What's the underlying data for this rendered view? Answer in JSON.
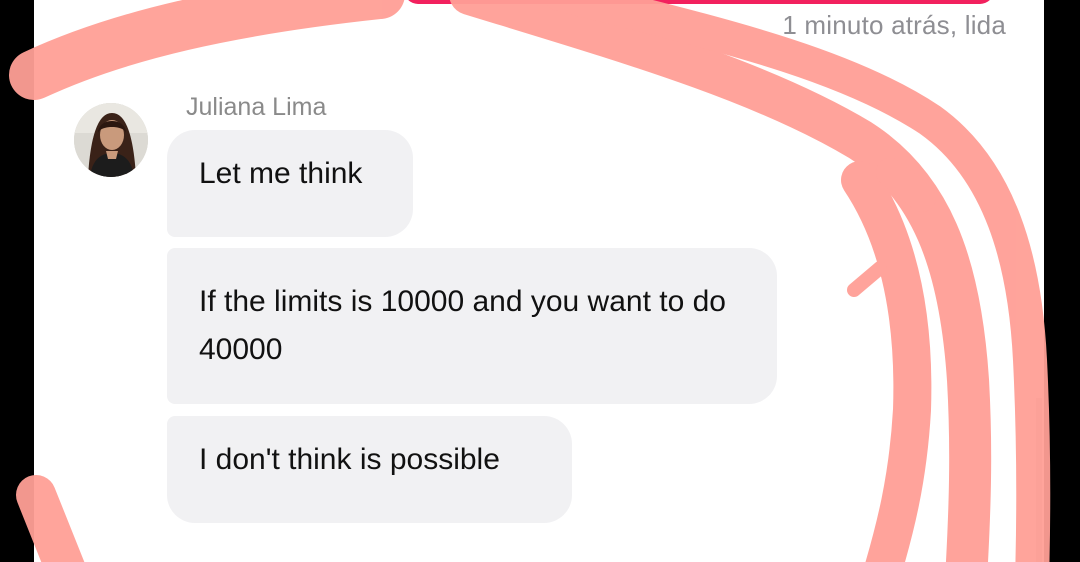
{
  "message_meta": {
    "timestamp": "1 minuto atrás, lida"
  },
  "sender": {
    "name": "Juliana Lima"
  },
  "messages": [
    {
      "text": "Let me think"
    },
    {
      "text": "If the limits is 10000 and you want to do 40000"
    },
    {
      "text": "I don't think is possible"
    }
  ],
  "colors": {
    "sent_bubble": "#f2215e",
    "received_bubble": "#f1f1f3",
    "annotation_stroke": "#ff9f96"
  },
  "icons": {
    "avatar": "profile-photo"
  }
}
